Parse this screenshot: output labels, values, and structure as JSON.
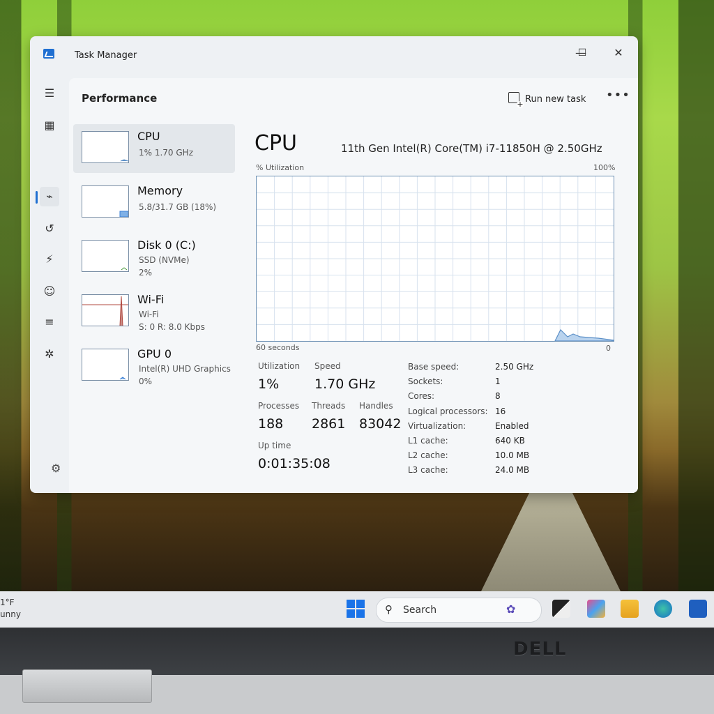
{
  "window": {
    "title": "Task Manager",
    "controls": {
      "minimize": "—",
      "maximize": "☐",
      "close": "✕"
    }
  },
  "header": {
    "page_title": "Performance",
    "run_new_task": "Run new task",
    "more": "•••"
  },
  "resources": [
    {
      "name": "CPU",
      "line1": "1%  1.70 GHz",
      "line2": "",
      "selected": true,
      "color": "#1f6fd1"
    },
    {
      "name": "Memory",
      "line1": "5.8/31.7 GB (18%)",
      "line2": "",
      "selected": false,
      "color": "#3b7fd6"
    },
    {
      "name": "Disk 0 (C:)",
      "line1": "SSD (NVMe)",
      "line2": "2%",
      "selected": false,
      "color": "#4a9a3a"
    },
    {
      "name": "Wi-Fi",
      "line1": "Wi-Fi",
      "line2": "S: 0  R: 8.0 Kbps",
      "selected": false,
      "color": "#b0483f"
    },
    {
      "name": "GPU 0",
      "line1": "Intel(R) UHD Graphics",
      "line2": "0%",
      "selected": false,
      "color": "#3b7fd6"
    }
  ],
  "cpu": {
    "heading": "CPU",
    "model": "11th Gen Intel(R) Core(TM) i7-11850H @ 2.50GHz",
    "util_label": "% Utilization",
    "util_max": "100%",
    "seconds_label": "60 seconds",
    "zero_label": "0",
    "graph_color": "#5b8fc7",
    "stats": {
      "utilization_label": "Utilization",
      "utilization": "1%",
      "speed_label": "Speed",
      "speed": "1.70 GHz",
      "processes_label": "Processes",
      "processes": "188",
      "threads_label": "Threads",
      "threads": "2861",
      "handles_label": "Handles",
      "handles": "83042",
      "uptime_label": "Up time",
      "uptime": "0:01:35:08"
    },
    "specs": [
      {
        "k": "Base speed:",
        "v": "2.50 GHz"
      },
      {
        "k": "Sockets:",
        "v": "1"
      },
      {
        "k": "Cores:",
        "v": "8"
      },
      {
        "k": "Logical processors:",
        "v": "16"
      },
      {
        "k": "Virtualization:",
        "v": "Enabled"
      },
      {
        "k": "L1 cache:",
        "v": "640 KB"
      },
      {
        "k": "L2 cache:",
        "v": "10.0 MB"
      },
      {
        "k": "L3 cache:",
        "v": "24.0 MB"
      }
    ]
  },
  "taskbar": {
    "weather_temp": "1°F",
    "weather_desc": "unny",
    "search_placeholder": "Search"
  },
  "brand": "DELL"
}
